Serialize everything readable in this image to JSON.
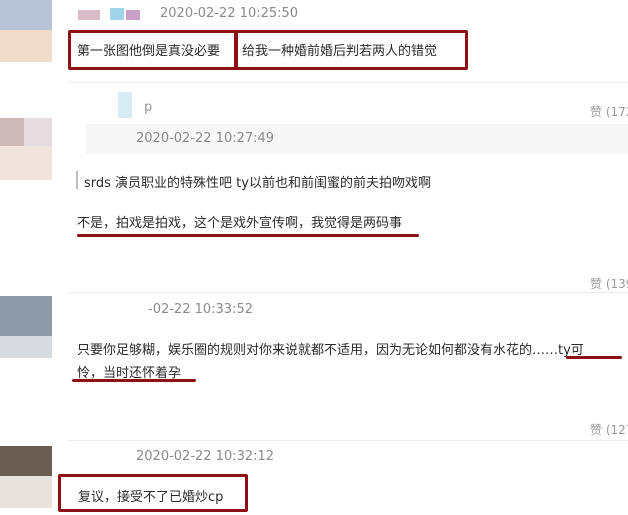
{
  "comments": [
    {
      "timestamp": "2020-02-22 10:25:50",
      "text_a": "第一张图他倒是真没必要",
      "text_b": "给我一种婚前婚后判若两人的错觉"
    },
    {
      "reply_user": "p",
      "like": "赞 (172",
      "reply_timestamp": "2020-02-22 10:27:49",
      "quoted": "srds 演员职业的特殊性吧 ty以前也和前闺蜜的前夫拍吻戏啊",
      "text": "不是，拍戏是拍戏，这个是戏外宣传啊，我觉得是两码事"
    },
    {
      "like": "赞 (139",
      "timestamp": "-02-22 10:33:52",
      "text_line1": "只要你足够糊，娱乐圈的规则对你来说就都不适用，因为无论如何都没有水花的……ty可",
      "text_line2": "怜，当时还怀着孕"
    },
    {
      "like": "赞 (127",
      "timestamp": "2020-02-22 10:32:12",
      "text": "复议，接受不了已婚炒cp"
    }
  ]
}
